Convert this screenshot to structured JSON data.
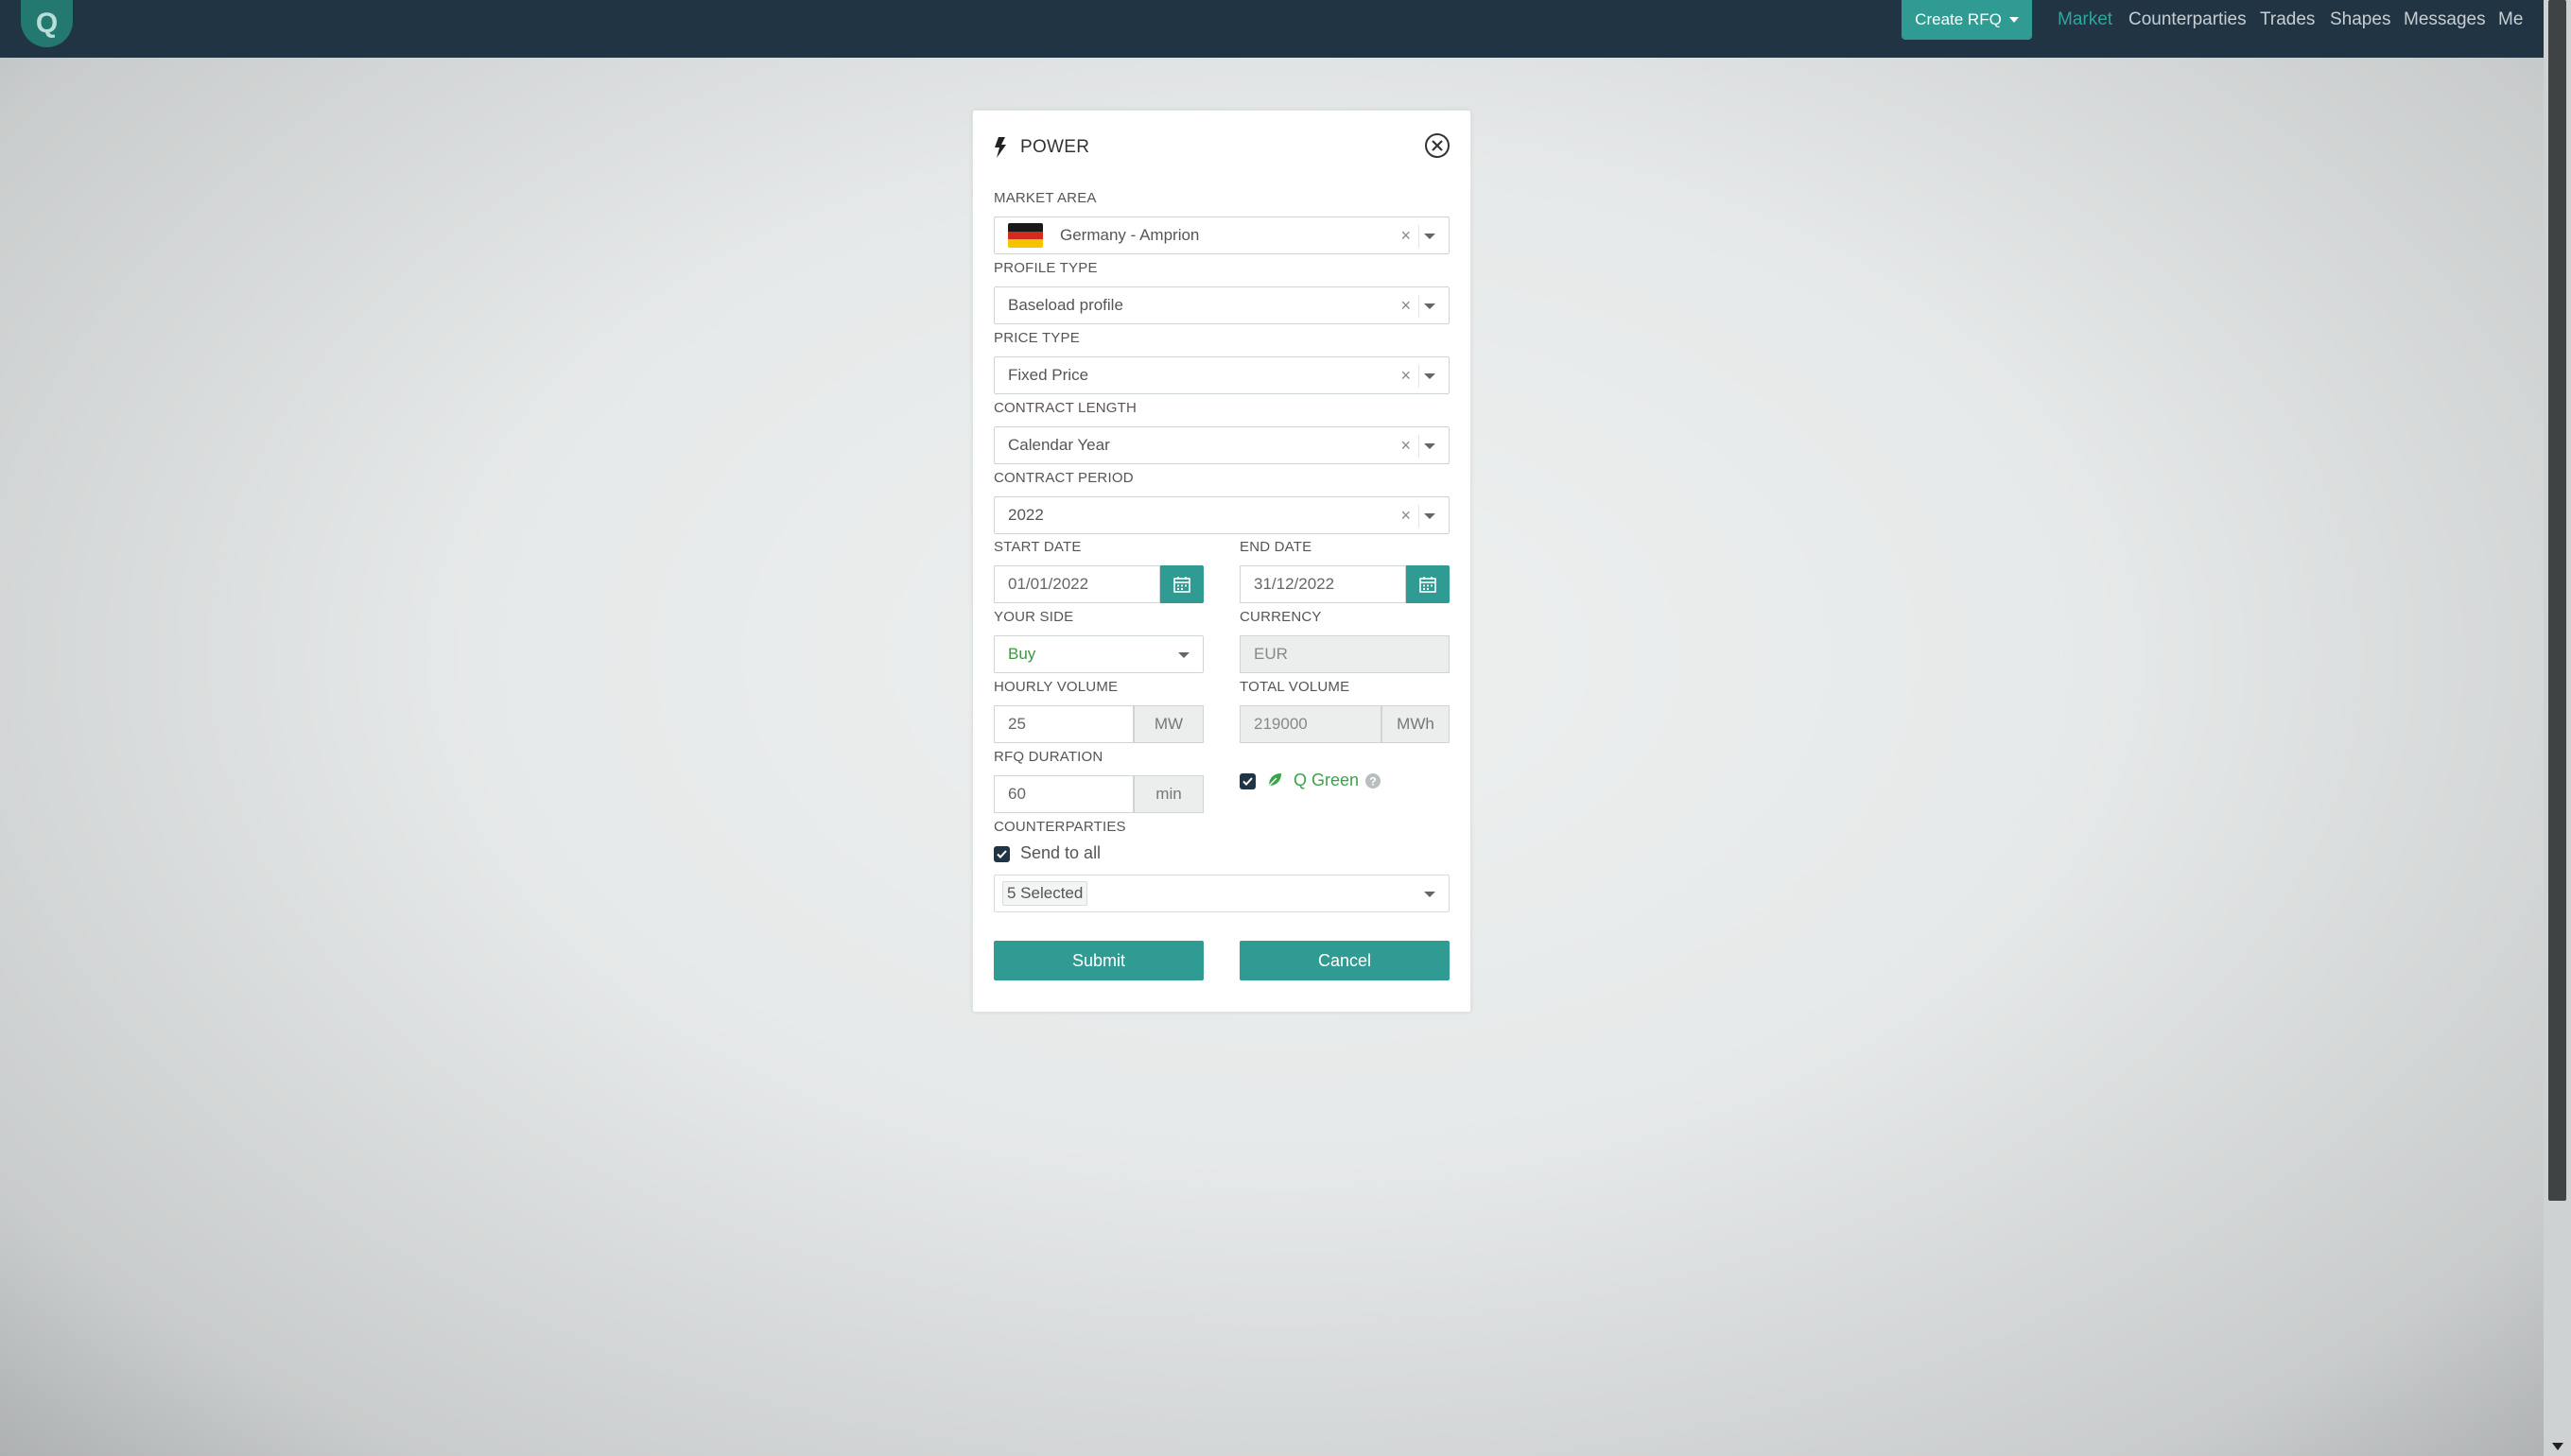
{
  "topbar": {
    "logo_letter": "Q",
    "create_rfq_label": "Create RFQ",
    "nav": [
      "Market",
      "Counterparties",
      "Trades",
      "Shapes",
      "Messages",
      "Me"
    ],
    "active_nav": "Market"
  },
  "modal": {
    "title": "POWER",
    "fields": {
      "market_area": {
        "label": "MARKET AREA",
        "value": "Germany - Amprion"
      },
      "profile_type": {
        "label": "PROFILE TYPE",
        "value": "Baseload profile"
      },
      "price_type": {
        "label": "PRICE TYPE",
        "value": "Fixed Price"
      },
      "contract_length": {
        "label": "CONTRACT LENGTH",
        "value": "Calendar Year"
      },
      "contract_period": {
        "label": "CONTRACT PERIOD",
        "value": "2022"
      },
      "start_date": {
        "label": "START DATE",
        "value": "01/01/2022"
      },
      "end_date": {
        "label": "END DATE",
        "value": "31/12/2022"
      },
      "your_side": {
        "label": "YOUR SIDE",
        "value": "Buy"
      },
      "currency": {
        "label": "CURRENCY",
        "value": "EUR"
      },
      "hourly_volume": {
        "label": "HOURLY VOLUME",
        "value": "25",
        "unit": "MW"
      },
      "total_volume": {
        "label": "TOTAL VOLUME",
        "value": "219000",
        "unit": "MWh"
      },
      "rfq_duration": {
        "label": "RFQ DURATION",
        "value": "60",
        "unit": "min"
      },
      "q_green": {
        "label": "Q Green",
        "checked": true
      },
      "counterparties": {
        "label": "COUNTERPARTIES",
        "send_to_all_label": "Send to all",
        "send_to_all_checked": true,
        "selected": "5 Selected"
      }
    },
    "submit_label": "Submit",
    "cancel_label": "Cancel",
    "clear_symbol": "×"
  },
  "colors": {
    "topbar": "#203444",
    "accent": "#2f9b93",
    "active_nav": "#2ea79b",
    "buy_text": "#3a9a3a",
    "green_text": "#3aa34a"
  },
  "icons": [
    "bolt-icon",
    "close-circle-icon",
    "calendar-icon",
    "leaf-icon",
    "question-circle-icon",
    "germany-flag-icon"
  ]
}
